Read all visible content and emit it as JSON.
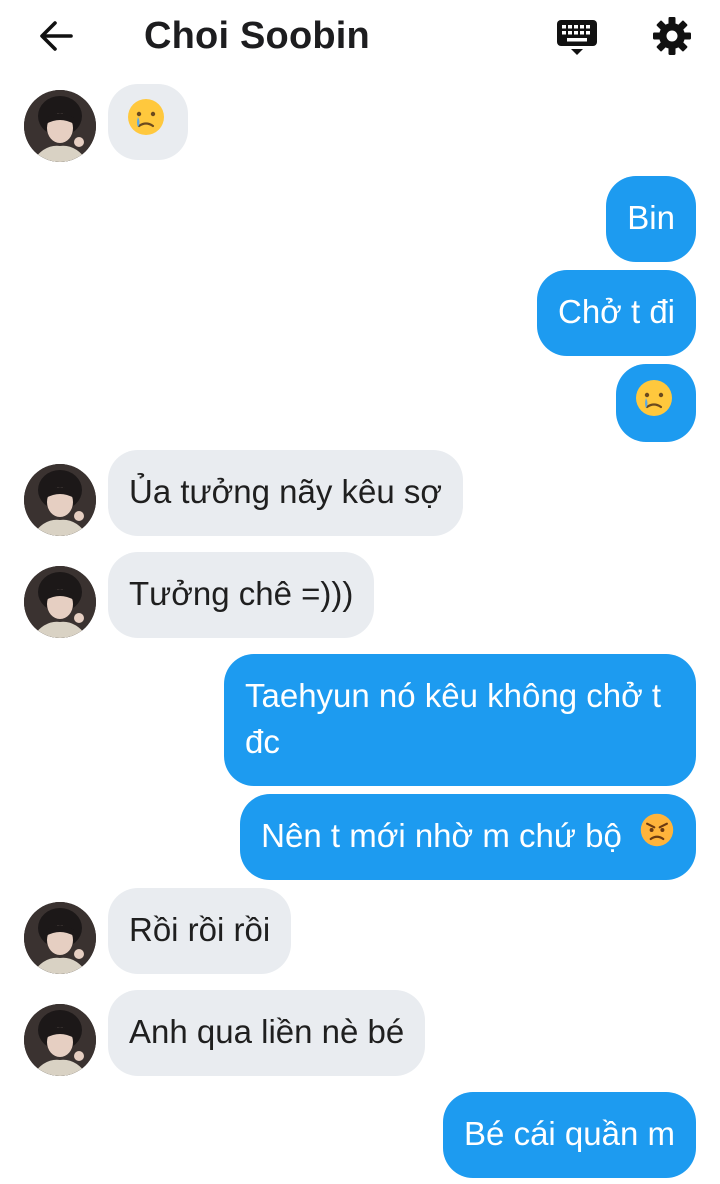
{
  "header": {
    "title": "Choi Soobin",
    "back_icon": "arrow-left-icon",
    "keyboard_icon": "keyboard-icon",
    "settings_icon": "gear-icon"
  },
  "colors": {
    "outgoing_bubble": "#1d9bf0",
    "incoming_bubble": "#e9ecf0",
    "outgoing_text": "#ffffff",
    "incoming_text": "#1f1f1f"
  },
  "messages": [
    {
      "side": "in",
      "text": "",
      "emoji": "crying-face"
    },
    {
      "side": "out",
      "text": "Bin"
    },
    {
      "side": "out",
      "text": "Chở t đi"
    },
    {
      "side": "out",
      "text": "",
      "emoji": "crying-face"
    },
    {
      "side": "in",
      "text": "Ủa tưởng nãy kêu sợ"
    },
    {
      "side": "in",
      "text": "Tưởng chê =)))"
    },
    {
      "side": "out",
      "text": "Taehyun nó kêu không chở t đc"
    },
    {
      "side": "out",
      "text": "Nên t mới nhờ m chứ bộ",
      "emoji": "angry-face"
    },
    {
      "side": "in",
      "text": "Rồi rồi rồi"
    },
    {
      "side": "in",
      "text": "Anh qua liền nè bé"
    },
    {
      "side": "out",
      "text": "Bé cái quần m"
    }
  ]
}
